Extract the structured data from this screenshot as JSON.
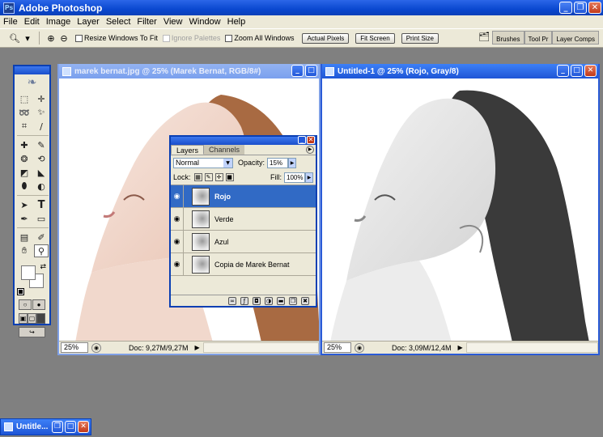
{
  "app": {
    "title": "Adobe Photoshop",
    "logo": "Ps"
  },
  "window_buttons": {
    "minimize": "_",
    "restore": "❐",
    "close": "✕"
  },
  "menu": [
    "File",
    "Edit",
    "Image",
    "Layer",
    "Select",
    "Filter",
    "View",
    "Window",
    "Help"
  ],
  "options_bar": {
    "tool_icon": "zoom-icon",
    "resize_windows": "Resize Windows To Fit",
    "ignore_palettes": "Ignore Palettes",
    "zoom_all": "Zoom All Windows",
    "actual_pixels": "Actual Pixels",
    "fit_screen": "Fit Screen",
    "print_size": "Print Size",
    "palette_tabs": [
      "Brushes",
      "Tool Pr",
      "Layer Comps"
    ]
  },
  "documents": [
    {
      "title": "marek bernat.jpg @ 25% (Marek Bernat, RGB/8#)",
      "zoom": "25%",
      "doc_info": "Doc: 9,27M/9,27M"
    },
    {
      "title": "Untitled-1 @ 25% (Rojo, Gray/8)",
      "zoom": "25%",
      "doc_info": "Doc: 3,09M/12,4M"
    }
  ],
  "minimized": {
    "title": "Untitle..."
  },
  "layers_panel": {
    "tabs": [
      "Layers",
      "Channels"
    ],
    "blend_mode": "Normal",
    "opacity_label": "Opacity:",
    "opacity": "15%",
    "lock_label": "Lock:",
    "fill_label": "Fill:",
    "fill": "100%",
    "layers": [
      {
        "name": "Rojo",
        "selected": true
      },
      {
        "name": "Verde",
        "selected": false
      },
      {
        "name": "Azul",
        "selected": false
      },
      {
        "name": "Copia de Marek Bernat",
        "selected": false
      }
    ]
  },
  "colors": {
    "titlebar": "#0a48d0",
    "selected_layer": "#316ac5",
    "workspace": "#808080",
    "panel": "#ece9d8"
  }
}
